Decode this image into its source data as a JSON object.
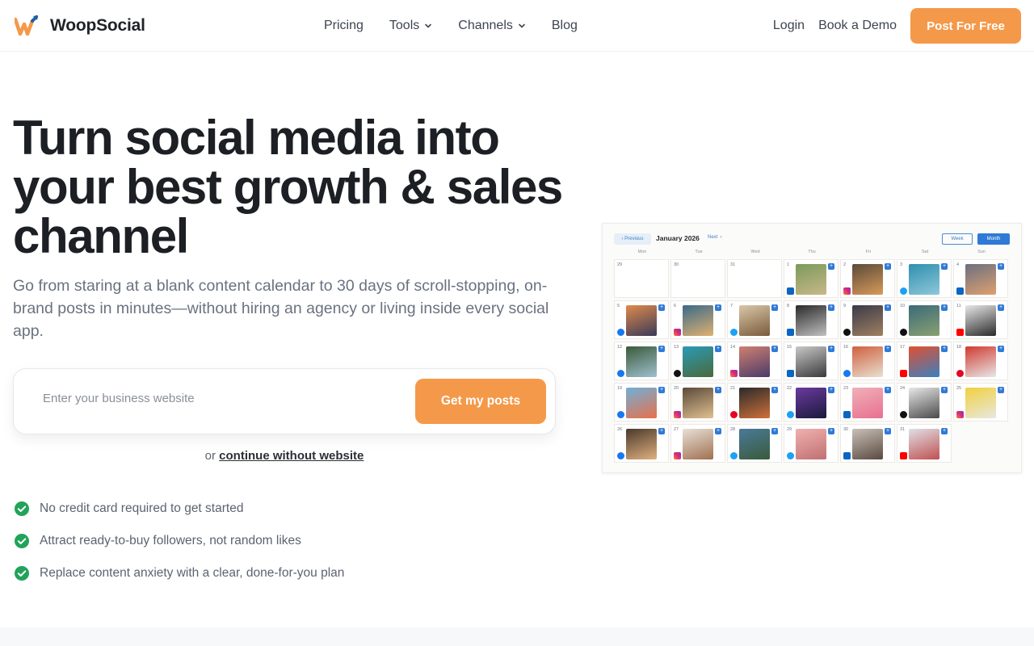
{
  "header": {
    "brand": "WoopSocial",
    "nav": [
      {
        "label": "Pricing",
        "has_menu": false
      },
      {
        "label": "Tools",
        "has_menu": true
      },
      {
        "label": "Channels",
        "has_menu": true
      },
      {
        "label": "Blog",
        "has_menu": false
      }
    ],
    "login_label": "Login",
    "demo_label": "Book a Demo",
    "cta_label": "Post For Free"
  },
  "hero": {
    "title": "Turn social media into your best growth & sales channel",
    "subtitle": "Go from staring at a blank content calendar to 30 days of scroll-stopping, on-brand posts in minutes—without hiring an agency or living inside every social app.",
    "input_placeholder": "Enter your business website",
    "button_label": "Get my posts",
    "alt_prefix": "or",
    "alt_link": "continue without website",
    "bullets": [
      "No credit card required to get started",
      "Attract ready-to-buy followers, not random likes",
      "Replace content anxiety with a clear, done-for-you plan"
    ]
  },
  "calendar": {
    "prev_label": "Previous",
    "month_label": "January 2026",
    "next_label": "Next",
    "week_label": "Week",
    "month_view_label": "Month",
    "days_of_week": [
      "Mon",
      "Tue",
      "Wed",
      "Thu",
      "Fri",
      "Sat",
      "Sun"
    ],
    "cells": [
      {
        "day": "29",
        "post": false
      },
      {
        "day": "30",
        "post": false
      },
      {
        "day": "31",
        "post": false
      },
      {
        "day": "1",
        "post": true,
        "network": "linkedin",
        "colors": [
          "#7a9a5a",
          "#c9b88a"
        ]
      },
      {
        "day": "2",
        "post": true,
        "network": "instagram",
        "colors": [
          "#5a4a3a",
          "#d89a5a"
        ]
      },
      {
        "day": "3",
        "post": true,
        "network": "twitter",
        "colors": [
          "#2f8fb0",
          "#8fc7d8"
        ]
      },
      {
        "day": "4",
        "post": true,
        "network": "linkedin",
        "colors": [
          "#6a7080",
          "#e0a070"
        ]
      },
      {
        "day": "5",
        "post": true,
        "network": "facebook",
        "colors": [
          "#e08a4a",
          "#3a3a5a"
        ]
      },
      {
        "day": "6",
        "post": true,
        "network": "instagram",
        "colors": [
          "#3a6a8a",
          "#e0b070"
        ]
      },
      {
        "day": "7",
        "post": true,
        "network": "twitter",
        "colors": [
          "#d8c8a8",
          "#7a5a3a"
        ]
      },
      {
        "day": "8",
        "post": true,
        "network": "linkedin",
        "colors": [
          "#2a2a2a",
          "#c0c0c0"
        ]
      },
      {
        "day": "9",
        "post": true,
        "network": "tiktok",
        "colors": [
          "#3a3a4a",
          "#a08060"
        ]
      },
      {
        "day": "10",
        "post": true,
        "network": "tiktok",
        "colors": [
          "#3a6a7a",
          "#8aa070"
        ]
      },
      {
        "day": "11",
        "post": true,
        "network": "youtube",
        "colors": [
          "#e8e8e8",
          "#2a2a2a"
        ]
      },
      {
        "day": "12",
        "post": true,
        "network": "facebook",
        "colors": [
          "#3a5a3a",
          "#a0c0d0"
        ]
      },
      {
        "day": "13",
        "post": true,
        "network": "tiktok",
        "colors": [
          "#2a9ab8",
          "#4a6a3a"
        ]
      },
      {
        "day": "14",
        "post": true,
        "network": "instagram",
        "colors": [
          "#d08070",
          "#4a3a6a"
        ]
      },
      {
        "day": "15",
        "post": true,
        "network": "linkedin",
        "colors": [
          "#c8c8c8",
          "#3a3a3a"
        ]
      },
      {
        "day": "16",
        "post": true,
        "network": "facebook",
        "colors": [
          "#d06040",
          "#e8e0d0"
        ]
      },
      {
        "day": "17",
        "post": true,
        "network": "youtube",
        "colors": [
          "#e05030",
          "#3a80c0"
        ]
      },
      {
        "day": "18",
        "post": true,
        "network": "pinterest",
        "colors": [
          "#d03a30",
          "#e8e8e8"
        ]
      },
      {
        "day": "19",
        "post": true,
        "network": "facebook",
        "colors": [
          "#70b0d8",
          "#e8704a"
        ]
      },
      {
        "day": "20",
        "post": true,
        "network": "instagram",
        "colors": [
          "#5a4a3a",
          "#e0c090"
        ]
      },
      {
        "day": "21",
        "post": true,
        "network": "pinterest",
        "colors": [
          "#2a2a2a",
          "#d0703a"
        ]
      },
      {
        "day": "22",
        "post": true,
        "network": "twitter",
        "colors": [
          "#6a3aa0",
          "#1a1a3a"
        ]
      },
      {
        "day": "23",
        "post": true,
        "network": "linkedin",
        "colors": [
          "#f0b0b8",
          "#e87090"
        ]
      },
      {
        "day": "24",
        "post": true,
        "network": "tiktok",
        "colors": [
          "#e8e8e8",
          "#4a4a4a"
        ]
      },
      {
        "day": "25",
        "post": true,
        "network": "instagram",
        "colors": [
          "#f0d040",
          "#e8e8e0"
        ]
      },
      {
        "day": "26",
        "post": true,
        "network": "facebook",
        "colors": [
          "#4a3a2a",
          "#e0b080"
        ]
      },
      {
        "day": "27",
        "post": true,
        "network": "instagram",
        "colors": [
          "#e8e0d8",
          "#a07050"
        ]
      },
      {
        "day": "28",
        "post": true,
        "network": "twitter",
        "colors": [
          "#4a7a9a",
          "#3a5a3a"
        ]
      },
      {
        "day": "29",
        "post": true,
        "network": "twitter",
        "colors": [
          "#f0b0b0",
          "#c07070"
        ]
      },
      {
        "day": "30",
        "post": true,
        "network": "linkedin",
        "colors": [
          "#c8c0b8",
          "#5a4a40"
        ]
      },
      {
        "day": "31",
        "post": true,
        "network": "youtube",
        "colors": [
          "#e0e0e8",
          "#c05050"
        ]
      },
      {
        "day": "",
        "post": false,
        "empty": true
      }
    ]
  },
  "colors": {
    "accent": "#f4994a",
    "heading": "#1c1f23",
    "body": "#6a7280",
    "check": "#22a35a",
    "calendar_blue": "#2f7ad6"
  }
}
